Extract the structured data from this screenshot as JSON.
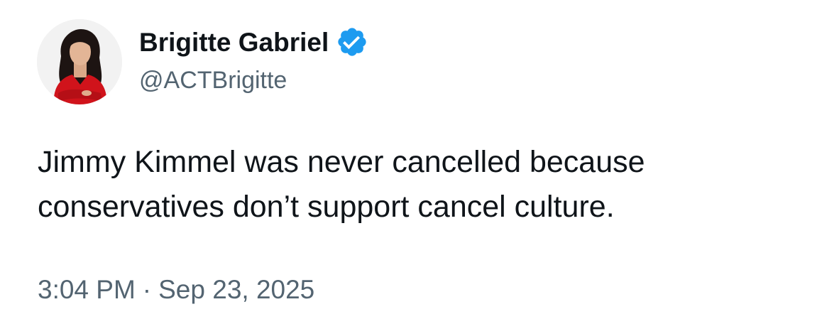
{
  "author": {
    "display_name": "Brigitte Gabriel",
    "handle": "@ACTBrigitte",
    "verified_icon": "verified-badge-icon",
    "verified_color": "#1d9bf0"
  },
  "tweet": {
    "text_lines": [
      "Jimmy Kimmel was never cancelled because",
      "conservatives don’t support cancel culture."
    ],
    "time": "3:04 PM",
    "separator": "·",
    "date": "Sep 23, 2025"
  },
  "colors": {
    "text_primary": "#0f1419",
    "text_secondary": "#536471",
    "background": "#ffffff"
  }
}
